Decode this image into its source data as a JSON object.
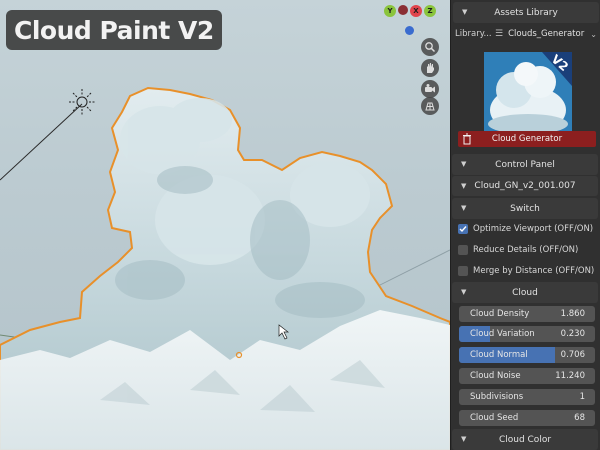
{
  "title": "Cloud Paint V2",
  "gizmo": {
    "axes": [
      {
        "label": "Y",
        "color": "#8ac43c"
      },
      {
        "label": "X",
        "color": "#e0444c"
      },
      {
        "label": "Z",
        "color": "#2f76d6"
      }
    ]
  },
  "nav_icons": [
    "zoom-icon",
    "hand-icon",
    "camera-icon",
    "grid-icon"
  ],
  "panel": {
    "assets_header": "Assets Library",
    "library_label": "Library...",
    "library_value": "Clouds_Generator",
    "thumbnail_badge": "V2",
    "generate_button": "Cloud Generator",
    "control_header": "Control Panel",
    "object_name": "Cloud_GN_v2_001.007",
    "switch_header": "Switch",
    "switches": [
      {
        "label": "Optimize Viewport (OFF/ON)",
        "checked": true
      },
      {
        "label": "Reduce Details (OFF/ON)",
        "checked": false
      },
      {
        "label": "Merge by Distance (OFF/ON)",
        "checked": false
      }
    ],
    "cloud_header": "Cloud",
    "sliders": [
      {
        "label": "Cloud Density",
        "value": "1.860",
        "fill": 0
      },
      {
        "label": "Cloud Variation",
        "value": "0.230",
        "fill": 0.23
      },
      {
        "label": "Cloud Normal",
        "value": "0.706",
        "fill": 0.706
      },
      {
        "label": "Cloud Noise",
        "value": "11.240",
        "fill": 0
      },
      {
        "label": "Subdivisions",
        "value": "1",
        "fill": 0
      },
      {
        "label": "Cloud Seed",
        "value": "68",
        "fill": 0
      }
    ],
    "color_header": "Cloud Color"
  },
  "colors": {
    "accent": "#4772b3",
    "danger": "#8c1f1f",
    "selection_outline": "#e8902a"
  }
}
